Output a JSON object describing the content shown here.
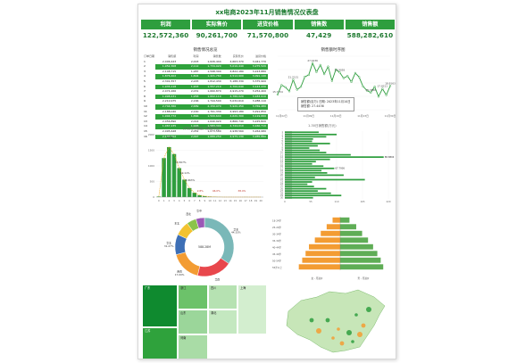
{
  "dashboard": {
    "title": "xx电商2023年11月销售情况仪表盘",
    "kpis": [
      {
        "label": "利润",
        "value": "122,572,360"
      },
      {
        "label": "实际售价",
        "value": "90,261,700"
      },
      {
        "label": "进货价格",
        "value": "71,570,800"
      },
      {
        "label": "销售数",
        "value": "47,429"
      },
      {
        "label": "销售额",
        "value": "588,282,610"
      }
    ],
    "panels": {
      "table_title": "销售情况总览",
      "line_title": "销售额时序图"
    },
    "tooltip": {
      "line1": "销售额(百万) 日期: 2023年11月10日",
      "line2": "销售额: 27.4436"
    },
    "hist_caption": "分布(订单数量) (数据标签)",
    "hbar_caption": "1-30日销售额(万元)",
    "butterfly_captions": {
      "left": "女 - 月进价",
      "right": "男 - 月进价"
    }
  },
  "table": {
    "headers": [
      "订单日期",
      "销售额",
      "利润",
      "销售数",
      "实际售价",
      "进货价格"
    ],
    "rows": [
      [
        "1",
        "2,006,443",
        "2,003",
        "1,626,444",
        "4,663,370",
        "3,041,770"
      ],
      [
        "2",
        "1,952,308",
        "2,112",
        "1,734,920",
        "5,010,440",
        "3,275,520"
      ],
      [
        "3",
        "2,148,715",
        "1,987",
        "1,598,300",
        "4,822,180",
        "3,223,880"
      ],
      [
        "4",
        "1,876,402",
        "1,804",
        "1,421,760",
        "4,512,900",
        "3,091,140"
      ],
      [
        "5",
        "2,301,557",
        "2,245",
        "1,812,430",
        "5,188,330",
        "3,375,900"
      ],
      [
        "6",
        "1,935,118",
        "1,903",
        "1,557,210",
        "4,700,640",
        "3,143,430"
      ],
      [
        "7",
        "2,074,266",
        "2,031",
        "1,660,870",
        "4,915,270",
        "3,254,400"
      ],
      [
        "8",
        "1,998,431",
        "1,958",
        "1,602,110",
        "4,786,020",
        "3,183,910"
      ],
      [
        "9",
        "2,210,975",
        "2,166",
        "1,744,500",
        "5,032,610",
        "3,288,110"
      ],
      [
        "10",
        "2,744,360",
        "2,689",
        "2,150,970",
        "5,920,450",
        "3,769,480"
      ],
      [
        "11",
        "2,188,040",
        "2,140",
        "1,701,330",
        "4,993,180",
        "3,291,850"
      ],
      [
        "12",
        "1,904,772",
        "1,866",
        "1,500,640",
        "4,620,300",
        "3,119,660"
      ],
      [
        "13",
        "2,056,890",
        "2,014",
        "1,640,920",
        "4,866,740",
        "3,225,820"
      ],
      [
        "14",
        "1,967,235",
        "1,926",
        "1,583,300",
        "4,744,010",
        "3,160,710"
      ],
      [
        "15",
        "2,095,648",
        "2,052",
        "1,673,580",
        "4,938,560",
        "3,264,980"
      ],
      [
        "16",
        "2,140,702",
        "2,097",
        "1,689,250",
        "4,975,130",
        "3,285,880"
      ]
    ]
  },
  "chart_data": [
    {
      "type": "line",
      "title": "销售额时序图",
      "x": [
        "11月01日",
        "11月02日",
        "11月03日",
        "11月04日",
        "11月05日",
        "11月06日",
        "11月07日",
        "11月08日",
        "11月09日",
        "11月10日",
        "11月11日",
        "11月12日",
        "11月13日",
        "11月14日",
        "11月15日",
        "11月16日",
        "11月17日",
        "11月18日",
        "11月19日",
        "11月20日",
        "11月21日",
        "11月22日",
        "11月23日",
        "11月24日",
        "11月25日",
        "11月26日",
        "11月27日",
        "11月28日",
        "11月29日",
        "11月30日"
      ],
      "xticks": [
        "11月02日",
        "11月09日",
        "11月16日",
        "11月23日",
        "11月30日"
      ],
      "values": [
        15.7,
        19.2,
        18.4,
        16.9,
        21.2,
        17.5,
        18.6,
        22.3,
        23.0,
        27.4,
        24.1,
        26.7,
        23.3,
        26.1,
        20.8,
        25.0,
        23.9,
        21.8,
        22.6,
        20.4,
        23.7,
        22.2,
        18.7,
        17.2,
        16.4,
        18.6,
        14.9,
        17.8,
        15.5,
        18.9
      ],
      "labels": [
        "15.7154",
        "",
        "",
        "",
        "21.2131",
        "",
        "",
        "",
        "",
        "27.4436",
        "",
        "",
        "",
        "",
        "",
        "",
        "23.9055",
        "",
        "",
        "",
        "",
        "",
        "",
        "",
        "16.3856",
        "",
        "",
        "17.8211",
        "",
        "18.9163"
      ],
      "ylim": [
        10,
        30
      ]
    },
    {
      "type": "bar",
      "title": "销售额分布",
      "categories": [
        "0",
        "1",
        "2",
        "3",
        "4",
        "5",
        "6",
        "7",
        "8",
        "9",
        "10",
        "11",
        "12",
        "13",
        "14",
        "15",
        "16",
        "17",
        "18",
        "19",
        "20"
      ],
      "values": [
        18,
        1250,
        1602,
        1380,
        930,
        560,
        290,
        140,
        60,
        30,
        14,
        8,
        4,
        2,
        2,
        1,
        1,
        3,
        1,
        2,
        1
      ],
      "annotations": [
        "1602",
        "53.507%",
        "19.11%",
        "5.963%",
        "2.8%",
        "46.0%",
        "38.4%"
      ],
      "ylim": [
        0,
        2000
      ]
    },
    {
      "type": "bar",
      "title": "1-30日销售额(万元)",
      "categories": [
        "1",
        "2",
        "3",
        "4",
        "5",
        "6",
        "7",
        "8",
        "9",
        "10",
        "11",
        "12",
        "13",
        "14",
        "15",
        "16",
        "17",
        "18",
        "19",
        "20",
        "21",
        "22",
        "23",
        "24",
        "25",
        "26",
        "27",
        "28",
        "29",
        "30"
      ],
      "values": [
        72,
        110,
        88,
        60,
        58,
        96,
        70,
        52,
        74,
        88,
        140,
        210,
        96,
        66,
        58,
        82,
        105,
        78,
        90,
        125,
        64,
        170,
        58,
        48,
        62,
        88,
        70,
        98,
        120,
        60
      ],
      "labels": [
        "",
        "",
        "",
        "",
        "",
        "",
        "",
        "",
        "",
        "",
        "",
        "88.8804",
        "",
        "",
        "",
        "",
        "67.7936",
        "",
        "",
        "",
        "",
        "",
        "",
        "",
        "",
        "",
        "",
        "",
        "",
        "",
        "18.8391"
      ],
      "xlim": [
        0,
        220
      ]
    },
    {
      "type": "pie",
      "title": "销售额构成",
      "center_label": "588.28M",
      "categories": [
        "华东",
        "华南",
        "西南",
        "华北",
        "东北",
        "西北",
        "华中"
      ],
      "values": [
        34.5,
        19.3,
        17.0,
        11.2,
        8.0,
        5.3,
        4.7
      ],
      "labels": [
        "44.33%",
        "",
        "17.00%",
        "31.27%",
        "",
        "",
        ""
      ]
    },
    {
      "type": "bar",
      "title": "男女客户月进价对比",
      "categories": [
        "18-24岁",
        "25-29岁",
        "30-34岁",
        "35-39岁",
        "40-44岁",
        "45-49岁",
        "50-54岁",
        "55岁以上"
      ],
      "series": [
        {
          "name": "女",
          "values": [
            18,
            32,
            46,
            60,
            74,
            82,
            90,
            98
          ]
        },
        {
          "name": "男",
          "values": [
            22,
            38,
            52,
            66,
            78,
            88,
            96,
            102
          ]
        }
      ]
    },
    {
      "type": "heatmap",
      "title": "各省销售额分布",
      "categories": [
        "广东",
        "江苏",
        "浙江",
        "山东",
        "河南",
        "四川",
        "湖北",
        "上海"
      ]
    }
  ]
}
